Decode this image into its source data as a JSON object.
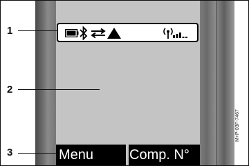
{
  "display": {
    "status_bar": {
      "icons": [
        "battery-icon",
        "bluetooth-icon",
        "transfer-icon",
        "warning-icon",
        "antenna-icon",
        "signal-strength-icon"
      ],
      "signal_level": 0.5
    },
    "softkeys": {
      "left_label": "Menu",
      "right_label": "Comp. N°"
    }
  },
  "callouts": {
    "one": "1",
    "two": "2",
    "three": "3"
  },
  "reference_code": "M+P-03F-7467",
  "colors": {
    "screen": "#c4c4c4",
    "softkey_bar": "#000000",
    "status_bar": "#ffffff"
  }
}
